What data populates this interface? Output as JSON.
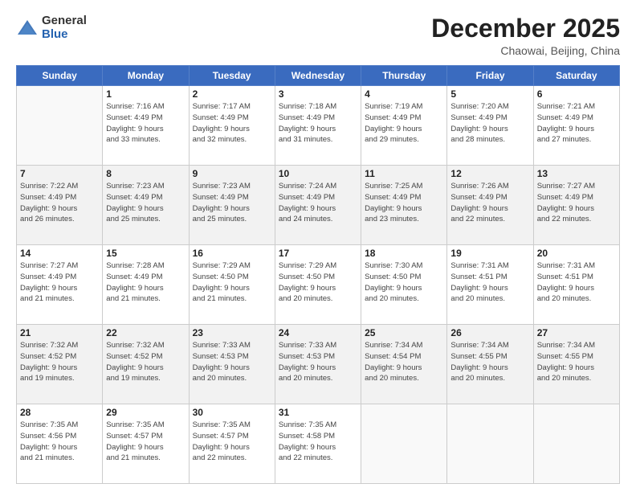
{
  "header": {
    "logo_general": "General",
    "logo_blue": "Blue",
    "month_title": "December 2025",
    "location": "Chaowai, Beijing, China"
  },
  "days_of_week": [
    "Sunday",
    "Monday",
    "Tuesday",
    "Wednesday",
    "Thursday",
    "Friday",
    "Saturday"
  ],
  "weeks": [
    [
      {
        "day": "",
        "info": ""
      },
      {
        "day": "1",
        "info": "Sunrise: 7:16 AM\nSunset: 4:49 PM\nDaylight: 9 hours\nand 33 minutes."
      },
      {
        "day": "2",
        "info": "Sunrise: 7:17 AM\nSunset: 4:49 PM\nDaylight: 9 hours\nand 32 minutes."
      },
      {
        "day": "3",
        "info": "Sunrise: 7:18 AM\nSunset: 4:49 PM\nDaylight: 9 hours\nand 31 minutes."
      },
      {
        "day": "4",
        "info": "Sunrise: 7:19 AM\nSunset: 4:49 PM\nDaylight: 9 hours\nand 29 minutes."
      },
      {
        "day": "5",
        "info": "Sunrise: 7:20 AM\nSunset: 4:49 PM\nDaylight: 9 hours\nand 28 minutes."
      },
      {
        "day": "6",
        "info": "Sunrise: 7:21 AM\nSunset: 4:49 PM\nDaylight: 9 hours\nand 27 minutes."
      }
    ],
    [
      {
        "day": "7",
        "info": "Sunrise: 7:22 AM\nSunset: 4:49 PM\nDaylight: 9 hours\nand 26 minutes."
      },
      {
        "day": "8",
        "info": "Sunrise: 7:23 AM\nSunset: 4:49 PM\nDaylight: 9 hours\nand 25 minutes."
      },
      {
        "day": "9",
        "info": "Sunrise: 7:23 AM\nSunset: 4:49 PM\nDaylight: 9 hours\nand 25 minutes."
      },
      {
        "day": "10",
        "info": "Sunrise: 7:24 AM\nSunset: 4:49 PM\nDaylight: 9 hours\nand 24 minutes."
      },
      {
        "day": "11",
        "info": "Sunrise: 7:25 AM\nSunset: 4:49 PM\nDaylight: 9 hours\nand 23 minutes."
      },
      {
        "day": "12",
        "info": "Sunrise: 7:26 AM\nSunset: 4:49 PM\nDaylight: 9 hours\nand 22 minutes."
      },
      {
        "day": "13",
        "info": "Sunrise: 7:27 AM\nSunset: 4:49 PM\nDaylight: 9 hours\nand 22 minutes."
      }
    ],
    [
      {
        "day": "14",
        "info": "Sunrise: 7:27 AM\nSunset: 4:49 PM\nDaylight: 9 hours\nand 21 minutes."
      },
      {
        "day": "15",
        "info": "Sunrise: 7:28 AM\nSunset: 4:49 PM\nDaylight: 9 hours\nand 21 minutes."
      },
      {
        "day": "16",
        "info": "Sunrise: 7:29 AM\nSunset: 4:50 PM\nDaylight: 9 hours\nand 21 minutes."
      },
      {
        "day": "17",
        "info": "Sunrise: 7:29 AM\nSunset: 4:50 PM\nDaylight: 9 hours\nand 20 minutes."
      },
      {
        "day": "18",
        "info": "Sunrise: 7:30 AM\nSunset: 4:50 PM\nDaylight: 9 hours\nand 20 minutes."
      },
      {
        "day": "19",
        "info": "Sunrise: 7:31 AM\nSunset: 4:51 PM\nDaylight: 9 hours\nand 20 minutes."
      },
      {
        "day": "20",
        "info": "Sunrise: 7:31 AM\nSunset: 4:51 PM\nDaylight: 9 hours\nand 20 minutes."
      }
    ],
    [
      {
        "day": "21",
        "info": "Sunrise: 7:32 AM\nSunset: 4:52 PM\nDaylight: 9 hours\nand 19 minutes."
      },
      {
        "day": "22",
        "info": "Sunrise: 7:32 AM\nSunset: 4:52 PM\nDaylight: 9 hours\nand 19 minutes."
      },
      {
        "day": "23",
        "info": "Sunrise: 7:33 AM\nSunset: 4:53 PM\nDaylight: 9 hours\nand 20 minutes."
      },
      {
        "day": "24",
        "info": "Sunrise: 7:33 AM\nSunset: 4:53 PM\nDaylight: 9 hours\nand 20 minutes."
      },
      {
        "day": "25",
        "info": "Sunrise: 7:34 AM\nSunset: 4:54 PM\nDaylight: 9 hours\nand 20 minutes."
      },
      {
        "day": "26",
        "info": "Sunrise: 7:34 AM\nSunset: 4:55 PM\nDaylight: 9 hours\nand 20 minutes."
      },
      {
        "day": "27",
        "info": "Sunrise: 7:34 AM\nSunset: 4:55 PM\nDaylight: 9 hours\nand 20 minutes."
      }
    ],
    [
      {
        "day": "28",
        "info": "Sunrise: 7:35 AM\nSunset: 4:56 PM\nDaylight: 9 hours\nand 21 minutes."
      },
      {
        "day": "29",
        "info": "Sunrise: 7:35 AM\nSunset: 4:57 PM\nDaylight: 9 hours\nand 21 minutes."
      },
      {
        "day": "30",
        "info": "Sunrise: 7:35 AM\nSunset: 4:57 PM\nDaylight: 9 hours\nand 22 minutes."
      },
      {
        "day": "31",
        "info": "Sunrise: 7:35 AM\nSunset: 4:58 PM\nDaylight: 9 hours\nand 22 minutes."
      },
      {
        "day": "",
        "info": ""
      },
      {
        "day": "",
        "info": ""
      },
      {
        "day": "",
        "info": ""
      }
    ]
  ]
}
